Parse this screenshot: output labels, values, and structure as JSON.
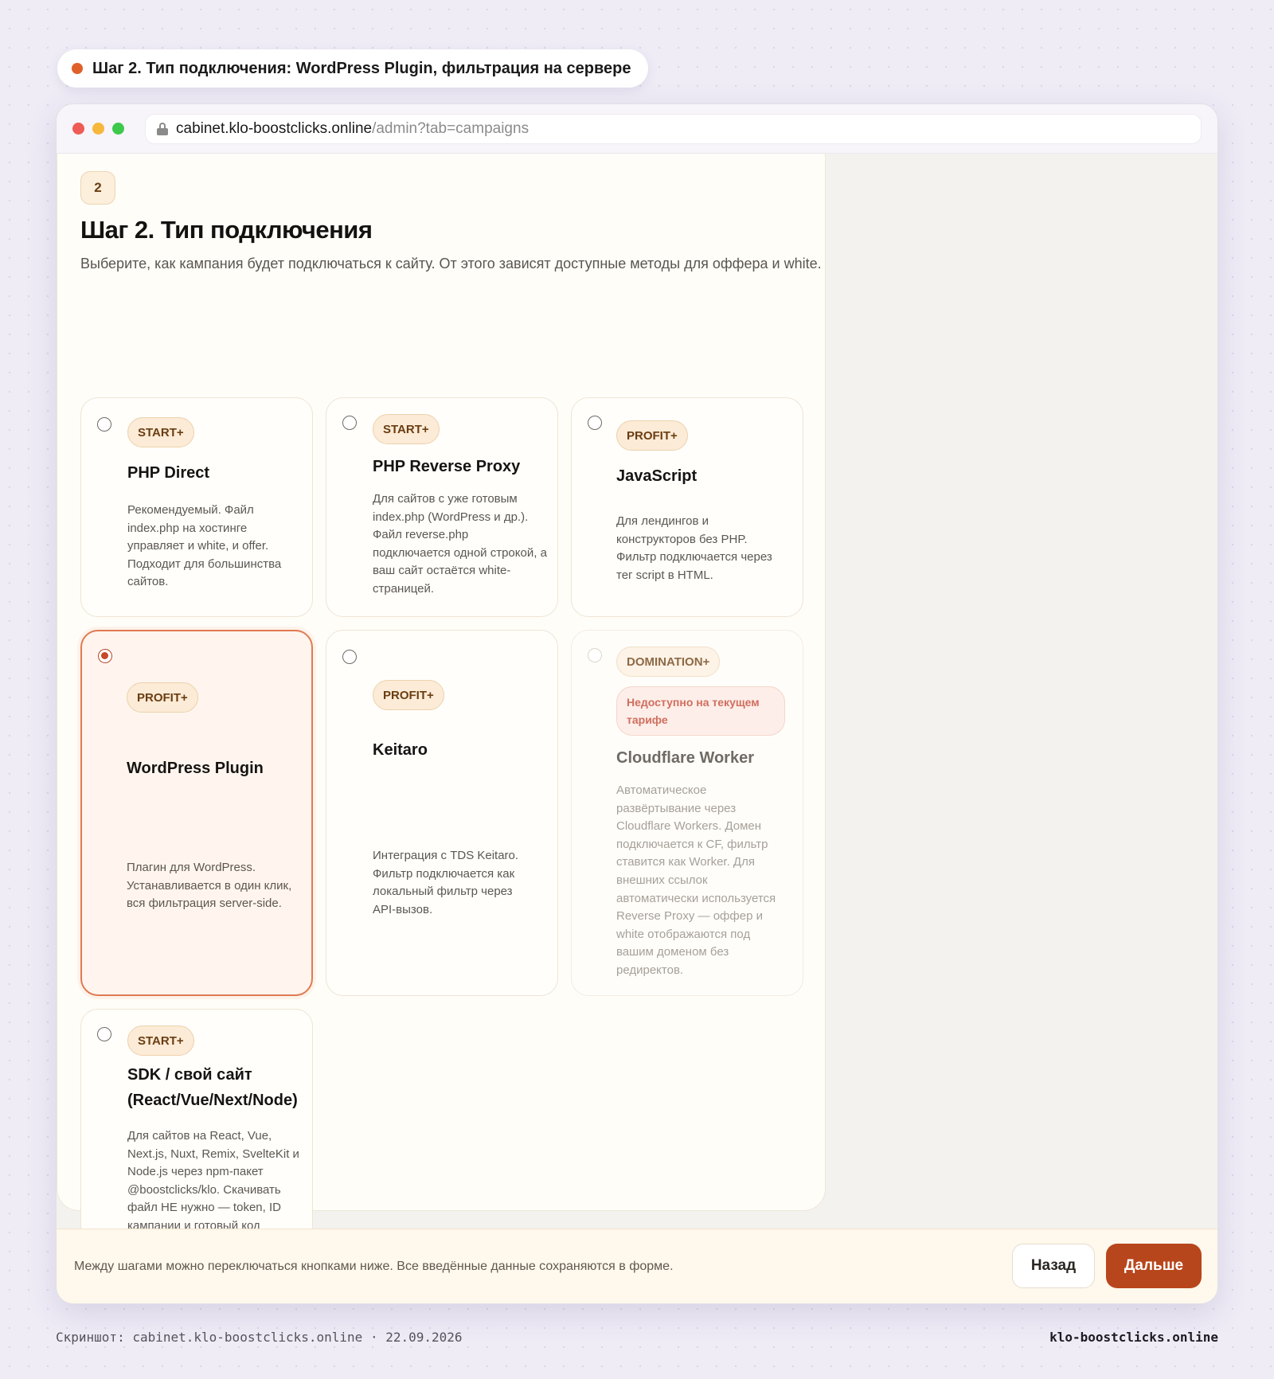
{
  "caption": "Шаг 2. Тип подключения: WordPress Plugin, фильтрация на сервере",
  "browser": {
    "url_host": "cabinet.klo-boostclicks.online",
    "url_path": "/admin?tab=campaigns"
  },
  "step": {
    "number": "2",
    "title": "Шаг 2. Тип подключения",
    "subtitle": "Выберите, как кампания будет подключаться к сайту. От этого зависят доступные методы для оффера и white."
  },
  "options": [
    {
      "tier": "START+",
      "title": "PHP Direct",
      "desc": "Рекомендуемый. Файл index.php на хостинге управляет и white, и offer. Подходит для большинства сайтов.",
      "selected": false,
      "disabled": false
    },
    {
      "tier": "START+",
      "title": "PHP Reverse Proxy",
      "desc": "Для сайтов с уже готовым index.php (WordPress и др.). Файл reverse.php подключается одной строкой, а ваш сайт остаётся white-страницей.",
      "selected": false,
      "disabled": false
    },
    {
      "tier": "PROFIT+",
      "title": "JavaScript",
      "desc": "Для лендингов и конструкторов без PHP. Фильтр подключается через тег script в HTML.",
      "selected": false,
      "disabled": false
    },
    {
      "tier": "PROFIT+",
      "title": "WordPress Plugin",
      "desc": "Плагин для WordPress. Устанавливается в один клик, вся фильтрация server-side.",
      "selected": true,
      "disabled": false
    },
    {
      "tier": "PROFIT+",
      "title": "Keitaro",
      "desc": "Интеграция с TDS Keitaro. Фильтр подключается как локальный фильтр через API-вызов.",
      "selected": false,
      "disabled": false
    },
    {
      "tier": "DOMINATION+",
      "warning": "Недоступно на текущем тарифе",
      "title": "Cloudflare Worker",
      "desc": "Автоматическое развёртывание через Cloudflare Workers. Домен подключается к CF, фильтр ставится как Worker. Для внешних ссылок автоматически используется Reverse Proxy — оффер и white отображаются под вашим доменом без редиректов.",
      "selected": false,
      "disabled": true
    },
    {
      "tier": "START+",
      "title": "SDK / свой сайт (React/Vue/Next/Node)",
      "desc": "Для сайтов на React, Vue, Next.js, Nuxt, Remix, SvelteKit и Node.js через npm-пакет @boostclicks/klo. Скачивать файл НЕ нужно — token, ID кампании и готовый код показываются на карточке кампании после создания.",
      "selected": false,
      "disabled": false
    }
  ],
  "footer": {
    "note": "Между шагами можно переключаться кнопками ниже. Все введённые данные сохраняются в форме.",
    "back_label": "Назад",
    "next_label": "Дальше"
  },
  "bottom": {
    "left": "Скриншот: cabinet.klo-boostclicks.online · 22.09.2026",
    "right": "klo-boostclicks.online"
  }
}
